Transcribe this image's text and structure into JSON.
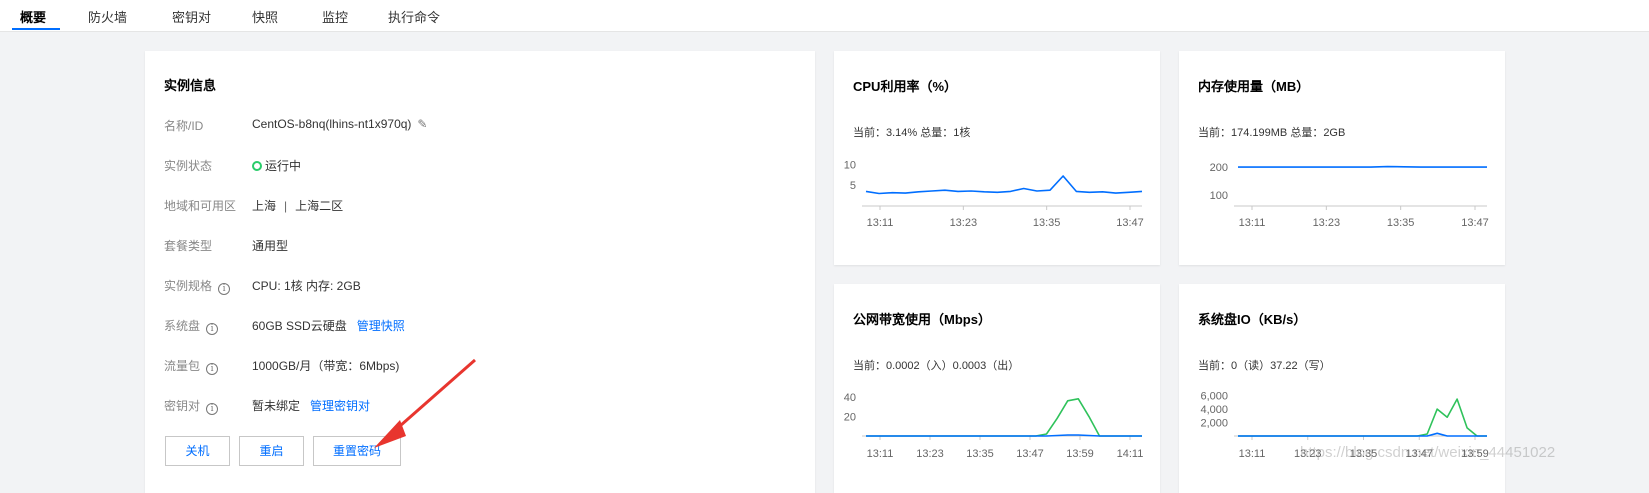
{
  "tabs": [
    "概要",
    "防火墙",
    "密钥对",
    "快照",
    "监控",
    "执行命令"
  ],
  "active_tab": "概要",
  "instance": {
    "title": "实例信息",
    "rows": {
      "name": {
        "label": "名称/ID",
        "value": "CentOS-b8nq(lhins-nt1x970q)"
      },
      "status": {
        "label": "实例状态",
        "value": "运行中"
      },
      "region": {
        "label": "地域和可用区",
        "region": "上海",
        "separator": "|",
        "zone": "上海二区"
      },
      "plan": {
        "label": "套餐类型",
        "value": "通用型"
      },
      "spec": {
        "label": "实例规格",
        "value": "CPU: 1核 内存: 2GB"
      },
      "disk": {
        "label": "系统盘",
        "value": "60GB SSD云硬盘",
        "link": "管理快照"
      },
      "traffic": {
        "label": "流量包",
        "value": "1000GB/月（带宽：6Mbps)"
      },
      "keypair": {
        "label": "密钥对",
        "value": "暂未绑定",
        "link": "管理密钥对"
      }
    },
    "info_icon": "i",
    "buttons": {
      "shutdown": "关机",
      "restart": "重启",
      "reset_password": "重置密码"
    }
  },
  "metrics": {
    "cpu": {
      "title": "CPU利用率（%）",
      "subtitle": "当前：3.14% 总量：1核"
    },
    "memory": {
      "title": "内存使用量（MB）",
      "subtitle": "当前：174.199MB 总量：2GB"
    },
    "bandwidth": {
      "title": "公网带宽使用（Mbps）",
      "subtitle": "当前：0.0002（入）0.0003（出）"
    },
    "disk_io": {
      "title": "系统盘IO（KB/s）",
      "subtitle": "当前：0（读）37.22（写）"
    }
  },
  "chart_data": [
    {
      "type": "line",
      "title": "CPU利用率（%）",
      "x": [
        "13:11",
        "13:23",
        "13:35",
        "13:47"
      ],
      "y_ticks": [
        5,
        10
      ],
      "ylim": [
        0,
        12
      ],
      "series": [
        {
          "color": "#006eff",
          "values": [
            3.5,
            3.0,
            3.2,
            3.1,
            3.4,
            3.6,
            3.8,
            3.5,
            3.6,
            3.4,
            3.3,
            3.5,
            4.2,
            3.6,
            3.8,
            7.2,
            3.5,
            3.3,
            3.4,
            3.1,
            3.3,
            3.5
          ]
        }
      ]
    },
    {
      "type": "line",
      "title": "内存使用量（MB）",
      "x": [
        "13:11",
        "13:23",
        "13:35",
        "13:47"
      ],
      "y_ticks": [
        100,
        200
      ],
      "ylim": [
        60,
        240
      ],
      "series": [
        {
          "color": "#006eff",
          "values": [
            200,
            200,
            200,
            200,
            200,
            200,
            200,
            200,
            200,
            202,
            201,
            200,
            200,
            200,
            200,
            200
          ]
        }
      ]
    },
    {
      "type": "line",
      "title": "公网带宽使用（Mbps）",
      "x": [
        "13:11",
        "13:23",
        "13:35",
        "13:47",
        "13:59",
        "14:11"
      ],
      "y_ticks": [
        20,
        40
      ],
      "ylim": [
        0,
        48
      ],
      "series": [
        {
          "color": "#2fc25b",
          "values": [
            0,
            0,
            0,
            0,
            0,
            0,
            0,
            0,
            0,
            0,
            0,
            0,
            0,
            0,
            0,
            0,
            0,
            2,
            18,
            36,
            38,
            20,
            0,
            0,
            0,
            0,
            0
          ]
        },
        {
          "color": "#006eff",
          "values": [
            0,
            0,
            0,
            0,
            0,
            0,
            0,
            0,
            0,
            0,
            0,
            0,
            0,
            0,
            0,
            0,
            0,
            0,
            0.5,
            1,
            1,
            0.5,
            0,
            0,
            0,
            0,
            0
          ]
        }
      ]
    },
    {
      "type": "line",
      "title": "系统盘IO（KB/s）",
      "x": [
        "13:11",
        "13:23",
        "13:35",
        "13:47",
        "13:59"
      ],
      "y_ticks": [
        "2,000",
        "4,000",
        "6,000"
      ],
      "y_tick_values": [
        2000,
        4000,
        6000
      ],
      "ylim": [
        0,
        7000
      ],
      "series": [
        {
          "color": "#2fc25b",
          "values": [
            0,
            0,
            0,
            0,
            0,
            0,
            0,
            0,
            0,
            0,
            0,
            0,
            0,
            0,
            0,
            0,
            0,
            0,
            0,
            300,
            4000,
            2800,
            5500,
            1200,
            0,
            0
          ]
        },
        {
          "color": "#006eff",
          "values": [
            0,
            0,
            0,
            0,
            0,
            0,
            0,
            0,
            0,
            0,
            0,
            0,
            0,
            0,
            0,
            0,
            0,
            0,
            0,
            0,
            400,
            0,
            0,
            0,
            0,
            0
          ]
        }
      ]
    }
  ],
  "watermark": "https://blog.csdn.net/weixin_44451022",
  "colors": {
    "accent": "#006eff",
    "running": "#29cc6a",
    "green_series": "#2fc25b"
  }
}
